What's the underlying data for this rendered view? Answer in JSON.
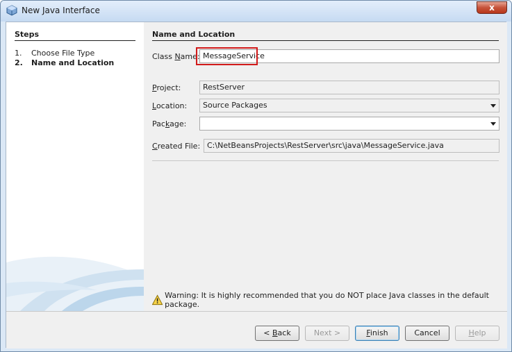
{
  "window": {
    "title": "New Java Interface",
    "close_glyph": "x"
  },
  "steps": {
    "title": "Steps",
    "items": [
      {
        "num": "1.",
        "label": "Choose File Type",
        "active": false
      },
      {
        "num": "2.",
        "label": "Name and Location",
        "active": true
      }
    ]
  },
  "form": {
    "section_title": "Name and Location",
    "class_name": {
      "label_pre": "Class ",
      "label_u": "N",
      "label_post": "ame:",
      "value": "MessageService"
    },
    "project": {
      "label_pre": "",
      "label_u": "P",
      "label_post": "roject:",
      "value": "RestServer"
    },
    "location": {
      "label_pre": "",
      "label_u": "L",
      "label_post": "ocation:",
      "value": "Source Packages"
    },
    "package": {
      "label_pre": "Pac",
      "label_u": "k",
      "label_post": "age:",
      "value": ""
    },
    "created_file": {
      "label_pre": "",
      "label_u": "C",
      "label_post": "reated File:",
      "value": "C:\\NetBeansProjects\\RestServer\\src\\java\\MessageService.java"
    }
  },
  "warning": {
    "text": "Warning: It is highly recommended that you do NOT place Java classes in the default package.",
    "icon": "warning-icon"
  },
  "buttons": {
    "back": {
      "pre": "< ",
      "u": "B",
      "post": "ack"
    },
    "next": {
      "label": "Next >"
    },
    "finish": {
      "pre": "",
      "u": "F",
      "post": "inish"
    },
    "cancel": {
      "label": "Cancel"
    },
    "help": {
      "pre": "",
      "u": "H",
      "post": "elp"
    }
  },
  "colors": {
    "highlight": "#d11a1a",
    "accent": "#3c7fb1"
  }
}
